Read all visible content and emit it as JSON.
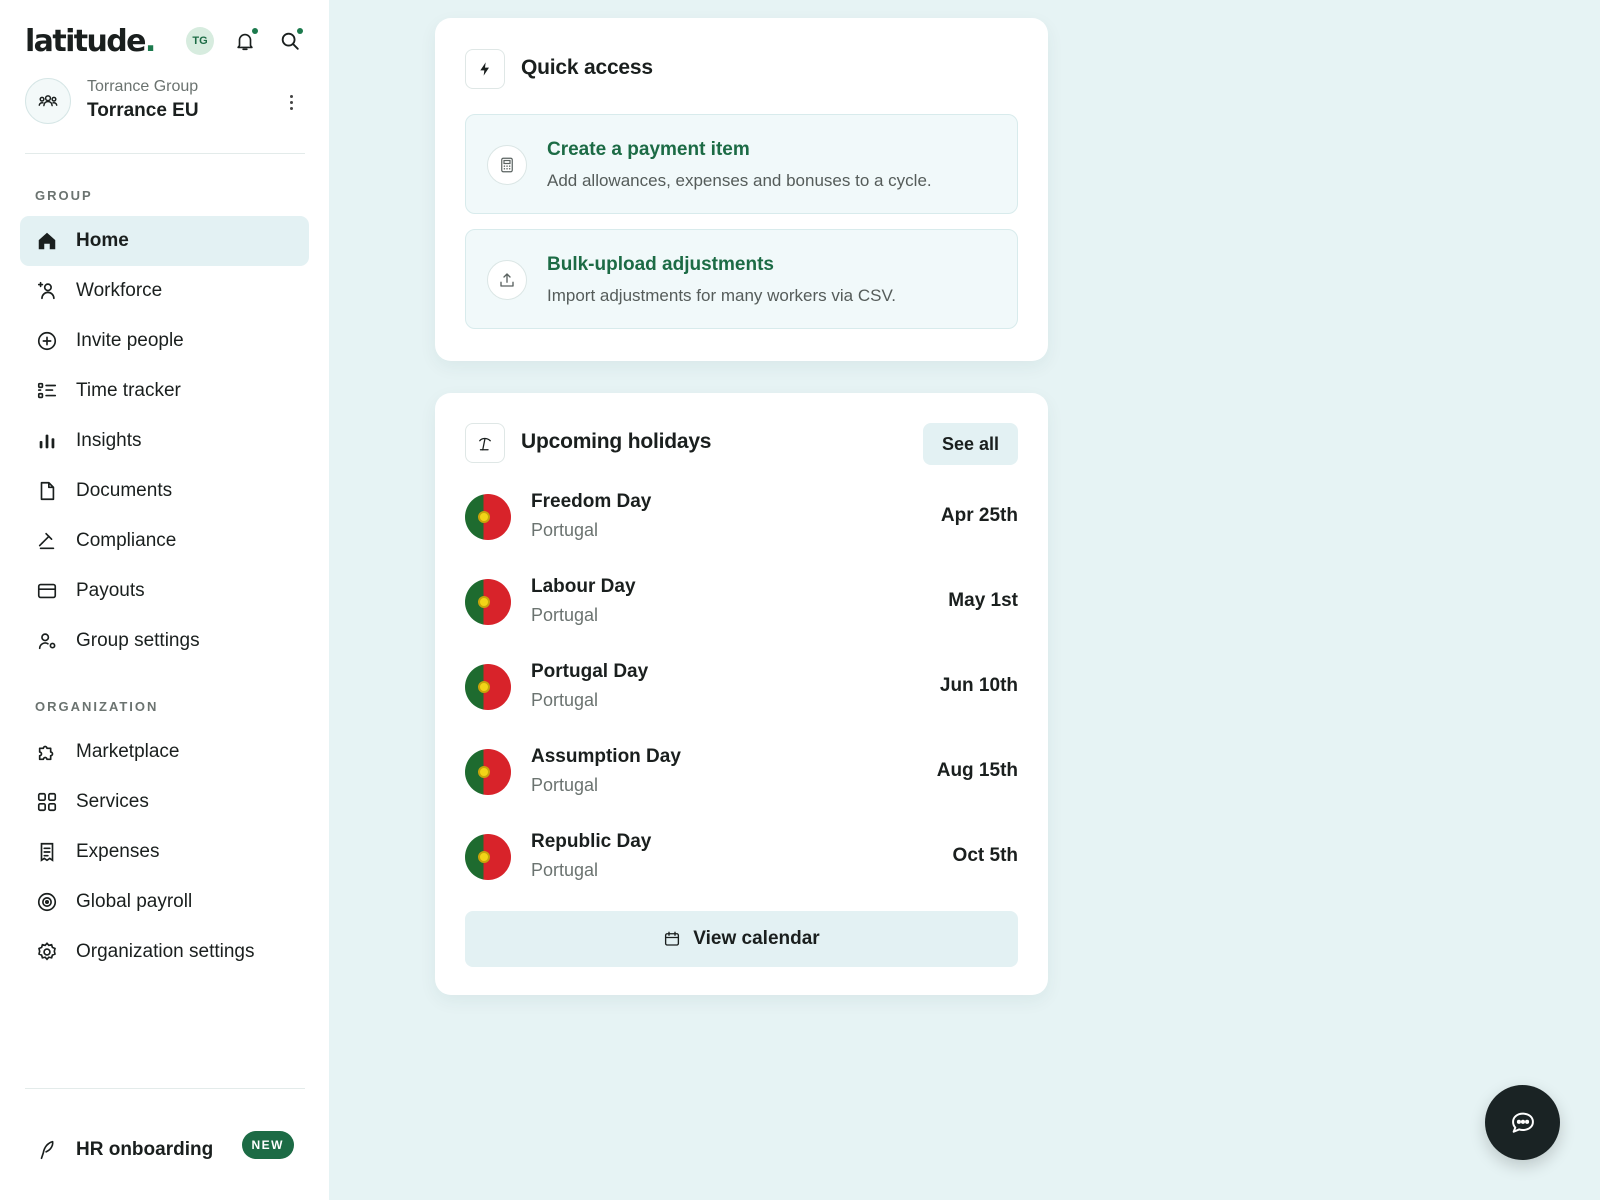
{
  "brand": {
    "name": "latitude",
    "dot": "."
  },
  "header": {
    "avatar_initials": "TG",
    "notification_icon": "bell-icon",
    "search_icon": "search-icon"
  },
  "org": {
    "parent": "Torrance Group",
    "name": "Torrance EU"
  },
  "sidebar": {
    "group_label": "GROUP",
    "group_items": [
      {
        "label": "Home",
        "icon": "home-icon",
        "active": true
      },
      {
        "label": "Workforce",
        "icon": "workforce-icon"
      },
      {
        "label": "Invite people",
        "icon": "plus-circle-icon"
      },
      {
        "label": "Time tracker",
        "icon": "checklist-icon"
      },
      {
        "label": "Insights",
        "icon": "bar-chart-icon"
      },
      {
        "label": "Documents",
        "icon": "document-icon"
      },
      {
        "label": "Compliance",
        "icon": "gavel-icon"
      },
      {
        "label": "Payouts",
        "icon": "card-icon"
      },
      {
        "label": "Group settings",
        "icon": "user-settings-icon"
      }
    ],
    "org_label": "ORGANIZATION",
    "org_items": [
      {
        "label": "Marketplace",
        "icon": "puzzle-icon"
      },
      {
        "label": "Services",
        "icon": "grid-icon"
      },
      {
        "label": "Expenses",
        "icon": "receipt-icon"
      },
      {
        "label": "Global payroll",
        "icon": "target-icon"
      },
      {
        "label": "Organization settings",
        "icon": "gear-icon"
      }
    ],
    "hr_onboarding": {
      "label": "HR onboarding",
      "badge": "NEW",
      "icon": "feather-icon"
    }
  },
  "quick_access": {
    "title": "Quick access",
    "items": [
      {
        "title": "Create a payment item",
        "description": "Add allowances, expenses and bonuses to a cycle.",
        "icon": "calculator-icon"
      },
      {
        "title": "Bulk-upload adjustments",
        "description": "Import adjustments for many workers via CSV.",
        "icon": "upload-icon"
      }
    ]
  },
  "holidays": {
    "title": "Upcoming holidays",
    "see_all": "See all",
    "items": [
      {
        "name": "Freedom Day",
        "country": "Portugal",
        "date": "Apr 25th"
      },
      {
        "name": "Labour Day",
        "country": "Portugal",
        "date": "May 1st"
      },
      {
        "name": "Portugal Day",
        "country": "Portugal",
        "date": "Jun 10th"
      },
      {
        "name": "Assumption Day",
        "country": "Portugal",
        "date": "Aug 15th"
      },
      {
        "name": "Republic Day",
        "country": "Portugal",
        "date": "Oct 5th"
      }
    ],
    "view_calendar": "View calendar"
  },
  "colors": {
    "brand_green": "#1c6b45",
    "accent_bg": "#e3f1f3",
    "page_bg": "#e6f3f4"
  }
}
